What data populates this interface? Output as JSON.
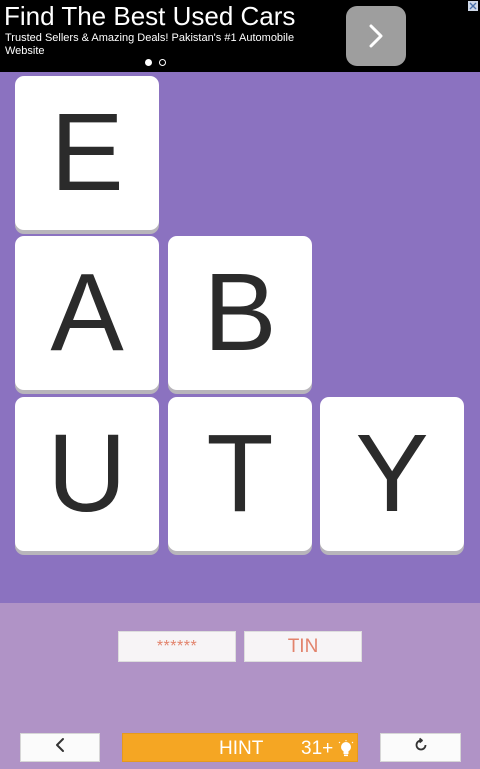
{
  "ad": {
    "title": "Find The Best Used Cars",
    "subtitle": "Trusted Sellers & Amazing Deals! Pakistan's #1 Automobile Website",
    "next_icon": "chevron-right-icon",
    "close_icon": "close-icon",
    "dots": [
      {
        "active": true
      },
      {
        "active": false
      }
    ]
  },
  "board": {
    "tiles": [
      {
        "letter": "E"
      },
      {
        "letter": "A"
      },
      {
        "letter": "B"
      },
      {
        "letter": "U"
      },
      {
        "letter": "T"
      },
      {
        "letter": "Y"
      }
    ]
  },
  "words": {
    "hidden": "******",
    "found": "TIN"
  },
  "controls": {
    "back_icon": "chevron-left-icon",
    "hint_label": "HINT",
    "hint_count": "31+",
    "hint_icon": "lightbulb-icon",
    "reset_icon": "refresh-icon"
  },
  "colors": {
    "board_bg": "#8b72c0",
    "panel_bg": "#b093c6",
    "hint_bg": "#f5a623",
    "word_text": "#e2836c"
  }
}
